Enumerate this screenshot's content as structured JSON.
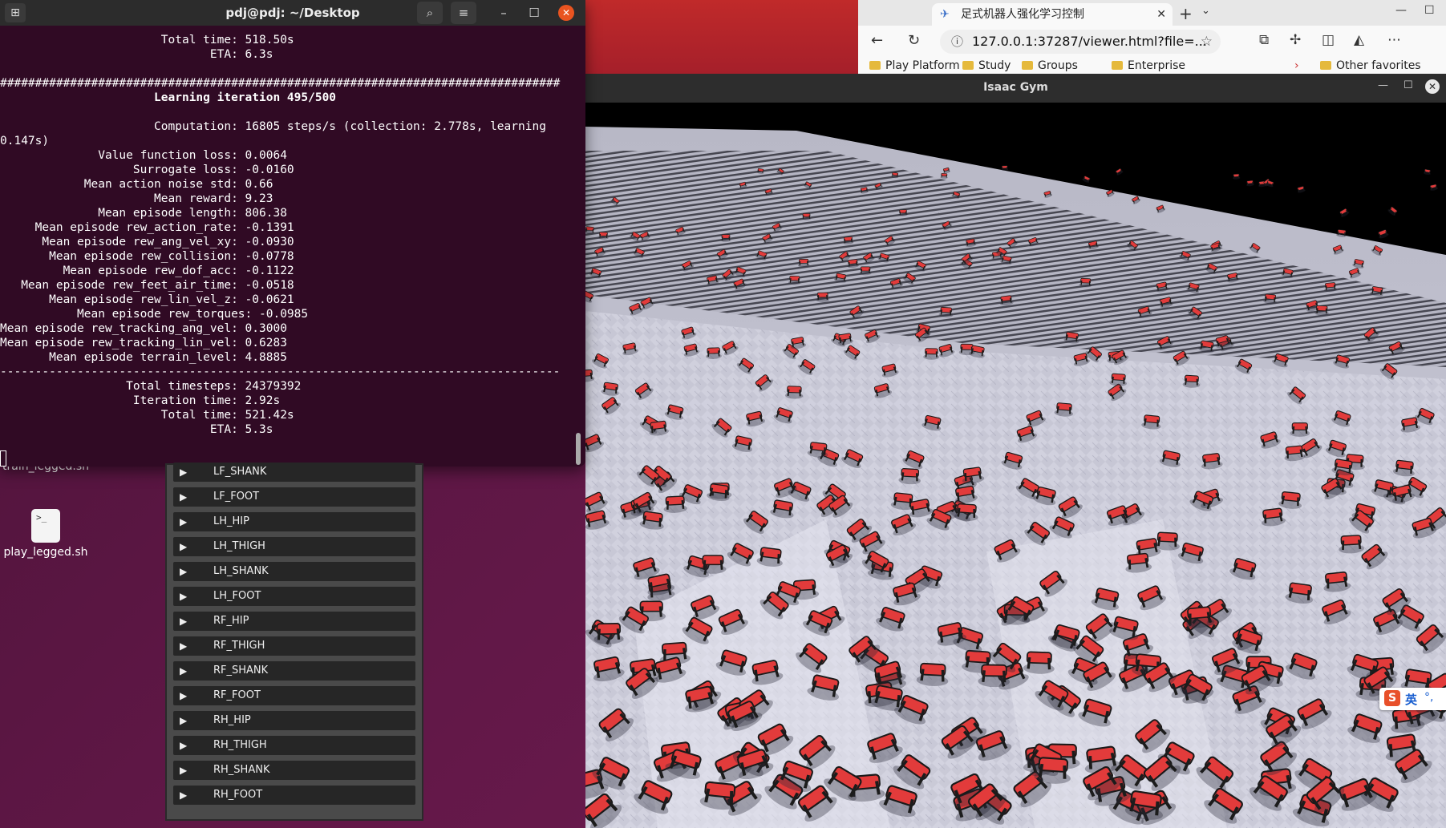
{
  "desktop": {
    "icons": [
      {
        "label": "train_legged.sh"
      },
      {
        "label": "play_legged.sh",
        "tile_text": ">_"
      }
    ]
  },
  "browser": {
    "tab_title": "足式机器人强化学习控制",
    "url": "127.0.0.1:37287/viewer.html?file=...",
    "bookmarks": [
      "Play Platform",
      "Study",
      "Groups",
      "Enterprise",
      "Other favorites"
    ]
  },
  "gym": {
    "title": "Isaac Gym"
  },
  "terminal": {
    "title": "pdj@pdj: ~/Desktop",
    "lines": [
      "                       Total time: 518.50s",
      "                              ETA: 6.3s",
      "",
      "################################################################################",
      "                      Learning iteration 495/500",
      "",
      "                      Computation: 16805 steps/s (collection: 2.778s, learning",
      "0.147s)",
      "              Value function loss: 0.0064",
      "                   Surrogate loss: -0.0160",
      "            Mean action noise std: 0.66",
      "                      Mean reward: 9.23",
      "              Mean episode length: 806.38",
      "     Mean episode rew_action_rate: -0.1391",
      "      Mean episode rew_ang_vel_xy: -0.0930",
      "       Mean episode rew_collision: -0.0778",
      "         Mean episode rew_dof_acc: -0.1122",
      "   Mean episode rew_feet_air_time: -0.0518",
      "       Mean episode rew_lin_vel_z: -0.0621",
      "           Mean episode rew_torques: -0.0985",
      "Mean episode rew_tracking_ang_vel: 0.3000",
      "Mean episode rew_tracking_lin_vel: 0.6283",
      "       Mean episode terrain_level: 4.8885",
      "--------------------------------------------------------------------------------",
      "                  Total timesteps: 24379392",
      "                   Iteration time: 2.92s",
      "                       Total time: 521.42s",
      "                              ETA: 5.3s"
    ]
  },
  "joint_panel": {
    "items": [
      "LF_SHANK",
      "LF_FOOT",
      "LH_HIP",
      "LH_THIGH",
      "LH_SHANK",
      "LH_FOOT",
      "RF_HIP",
      "RF_THIGH",
      "RF_SHANK",
      "RF_FOOT",
      "RH_HIP",
      "RH_THIGH",
      "RH_SHANK",
      "RH_FOOT"
    ]
  },
  "ime": {
    "label": "英"
  },
  "icons": {
    "expand": "triangle-right-icon",
    "new_tab": "new-tab-icon",
    "search": "search-icon",
    "menu": "hamburger-icon",
    "minimize": "minimize-icon",
    "maximize": "maximize-icon",
    "close": "close-icon"
  },
  "colors": {
    "terminal_bg": "#300a24",
    "terminal_close": "#e95420",
    "robot_red": "#e23b3b",
    "terrain": "#c9c9d6"
  }
}
